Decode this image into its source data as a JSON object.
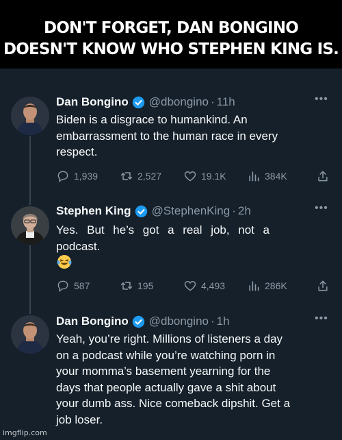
{
  "meme": {
    "caption_line1": "DON'T FORGET, DAN BONGINO",
    "caption_line2": "DOESN'T KNOW WHO STEPHEN KING IS."
  },
  "tweets": [
    {
      "name": "Dan Bongino",
      "handle": "@dbongino",
      "time": "11h",
      "text_lines": [
        "Biden is a disgrace to humankind. An",
        "embarrassment to the human race in every",
        "respect."
      ],
      "replies": "1,939",
      "retweets": "2,527",
      "likes": "19.1K",
      "views": "384K"
    },
    {
      "name": "Stephen King",
      "handle": "@StephenKing",
      "time": "2h",
      "text_lines": [
        "Yes. But he’s got a real job, not a",
        "podcast."
      ],
      "emoji": "laughing-tears",
      "replies": "587",
      "retweets": "195",
      "likes": "4,493",
      "views": "286K"
    },
    {
      "name": "Dan Bongino",
      "handle": "@dbongino",
      "time": "1h",
      "text_lines": [
        "Yeah, you’re right. Millions of listeners a day",
        "on a podcast while you’re watching porn in",
        "your momma’s basement yearning for the",
        "days that people actually gave a shit about",
        "your dumb ass. Nice comeback dipshit. Get a",
        "job loser."
      ]
    }
  ],
  "ui": {
    "dot": "·",
    "more": "•••"
  },
  "watermark": "imgflip.com",
  "colors": {
    "background": "#15202b",
    "verified": "#1d9bf0",
    "muted": "#8b98a5",
    "text": "#f7f9f9"
  }
}
